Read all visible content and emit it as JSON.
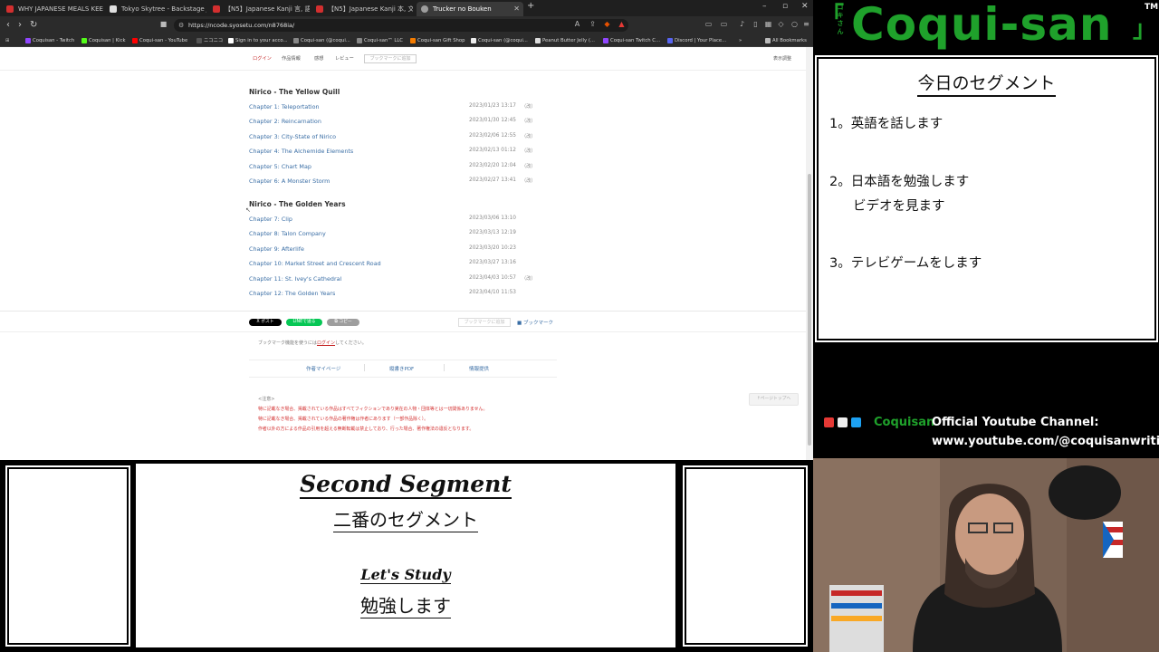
{
  "browser": {
    "tabs": [
      {
        "label": "WHY JAPANESE MEALS KEEP YOU TH",
        "active": false
      },
      {
        "label": "Tokyo Skytree - Backstage Japan | N",
        "active": false
      },
      {
        "label": "【N5】Japanese Kanji 言, 語, 話, 先,",
        "active": false
      },
      {
        "label": "【N5】Japanese Kanji 本, 文, 音, 右,",
        "active": false
      },
      {
        "label": "Trucker no Bouken",
        "active": true
      }
    ],
    "url": "https://ncode.syosetu.com/n8768ia/",
    "bookmarks": [
      "Coquisan - Twitch",
      "Coquisan | Kick",
      "Coqui-san - YouTube",
      "ニコニコ",
      "Sign in to your acco...",
      "Coqui-san (@coqui...",
      "Coqui-san™ LLC",
      "Coqui-san Gift Shop",
      "Coqui-san (@coqui...",
      "Peanut Butter Jelly (...",
      "Coqui-san Twitch C...",
      "Discord | Your Place...",
      "»",
      "All Bookmarks"
    ]
  },
  "page": {
    "nav": {
      "login": "ログイン",
      "info": "作品情報",
      "impression": "感想",
      "review": "レビュー",
      "add_bookmark": "ブックマークに追加",
      "display": "表示調整"
    },
    "sections": [
      {
        "title": "Nirico - The Yellow Quill",
        "chapters": [
          {
            "title": "Chapter 1: Teleportation",
            "date": "2023/01/23 13:17",
            "rev": "（改）"
          },
          {
            "title": "Chapter 2: Reincarnation",
            "date": "2023/01/30 12:45",
            "rev": "（改）"
          },
          {
            "title": "Chapter 3: City-State of Nirico",
            "date": "2023/02/06 12:55",
            "rev": "（改）"
          },
          {
            "title": "Chapter 4: The Alchemide Elements",
            "date": "2023/02/13 01:12",
            "rev": "（改）"
          },
          {
            "title": "Chapter 5: Chart Map",
            "date": "2023/02/20 12:04",
            "rev": "（改）"
          },
          {
            "title": "Chapter 6: A Monster Storm",
            "date": "2023/02/27 13:41",
            "rev": "（改）"
          }
        ]
      },
      {
        "title": "Nirico - The Golden Years",
        "chapters": [
          {
            "title": "Chapter 7: Clip",
            "date": "2023/03/06 13:10",
            "rev": ""
          },
          {
            "title": "Chapter 8: Talon Company",
            "date": "2023/03/13 12:19",
            "rev": ""
          },
          {
            "title": "Chapter 9: Afterlife",
            "date": "2023/03/20 10:23",
            "rev": ""
          },
          {
            "title": "Chapter 10: Market Street and Crescent Road",
            "date": "2023/03/27 13:16",
            "rev": ""
          },
          {
            "title": "Chapter 11: St. Ivey's Cathedral",
            "date": "2023/04/03 10:57",
            "rev": "（改）"
          },
          {
            "title": "Chapter 12: The Golden Years",
            "date": "2023/04/10 11:53",
            "rev": ""
          }
        ]
      }
    ],
    "share": {
      "post": "X ポスト",
      "line": "LINEで送る",
      "copy": "⧉ コピー"
    },
    "bookmark_add": "ブックマークに追加",
    "bookmark_link": "ブックマーク",
    "login_note_pre": "ブックマーク機能を使うには",
    "login_note_link": "ログイン",
    "login_note_post": "してください。",
    "footer_links": [
      "作者マイページ",
      "縦書きPDF",
      "情報提供"
    ],
    "notice_title": "<注意>",
    "notices": [
      "特に記載なき場合、掲載されている作品はすべてフィクションであり実在の人物・団体等とは一切関係ありません。",
      "特に記載なき場合、掲載されている作品の著作権は作者にあります（一部作品除く）。",
      "作者以外の方による作品の引用を超える無断転載は禁止しており、行った場合、著作権法の違反となります。"
    ],
    "page_top": "↑ページトップへ"
  },
  "overlay": {
    "brand": {
      "kana": "コキさん",
      "name": "Coqui-san",
      "tm": "TM",
      "bracket_open": "「",
      "bracket_close": "」"
    },
    "agenda": {
      "title": "今日のセグメント",
      "items": [
        "1。英語を話します",
        "2。日本語を勉強します",
        "3。テレビゲームをします"
      ],
      "sub": "ビデオを見ます"
    },
    "youtube": {
      "name": "Coquisan",
      "label": "Official Youtube Channel:",
      "url": "www.youtube.com/@coquisanwriting"
    },
    "segment": {
      "title_en": "Second Segment",
      "title_jp": "二番のセグメント",
      "study_en": "Let's Study",
      "study_jp": "勉強します"
    }
  },
  "colors": {
    "brand_green": "#1fa12b",
    "link_blue": "#3a6ea5",
    "notice_red": "#d32f2f"
  }
}
